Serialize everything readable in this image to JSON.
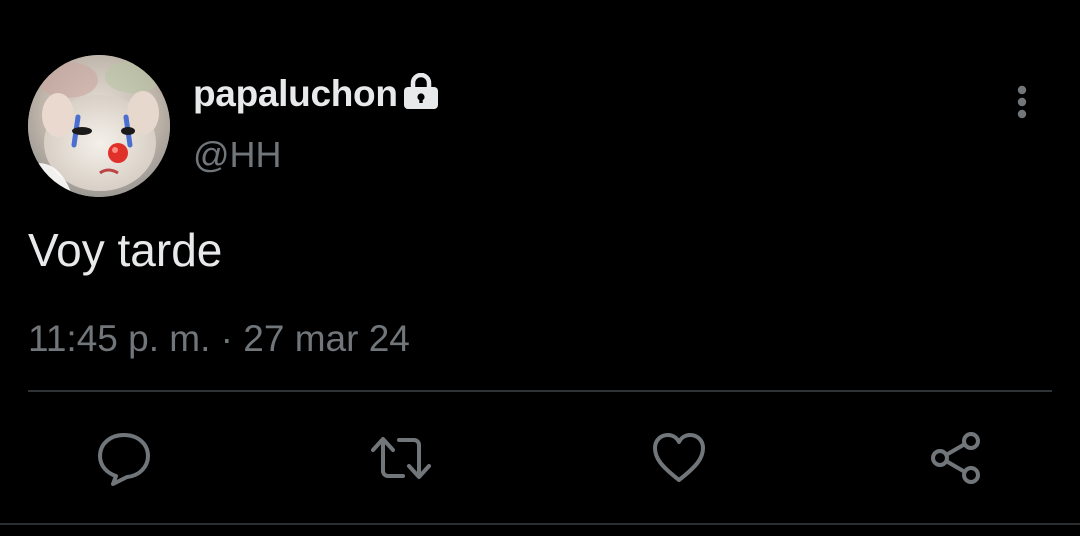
{
  "author": {
    "display_name": "papaluchon",
    "handle": "@HH",
    "protected": true,
    "avatar": "clown-kitten-avatar"
  },
  "tweet": {
    "text": "Voy tarde",
    "time": "11:45 p. m.",
    "separator": " · ",
    "date": "27 mar 24"
  },
  "actions": {
    "reply_icon": "speech-bubble-icon",
    "retweet_icon": "retweet-icon",
    "like_icon": "heart-icon",
    "share_icon": "share-icon"
  },
  "colors": {
    "background": "#000000",
    "primary_text": "#e7e9ea",
    "secondary_text": "#71767b",
    "divider": "#2f3336"
  }
}
